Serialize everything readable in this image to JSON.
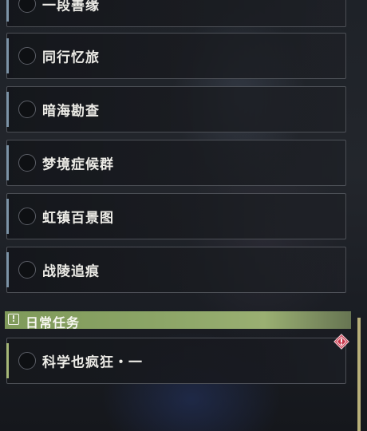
{
  "quests": [
    {
      "label": "一段善缘"
    },
    {
      "label": "同行忆旅"
    },
    {
      "label": "暗海勘查"
    },
    {
      "label": "梦境症候群"
    },
    {
      "label": "虹镇百景图"
    },
    {
      "label": "战陵追痕"
    }
  ],
  "daily": {
    "icon": "exclamation-icon",
    "title": "日常任务",
    "items": [
      {
        "label": "科学也疯狂・一",
        "badge": "alert-diamond-icon"
      }
    ]
  },
  "colors": {
    "accent_green": "#8ca567",
    "alert_red": "#c8364a",
    "item_border": "#7c93a6"
  }
}
